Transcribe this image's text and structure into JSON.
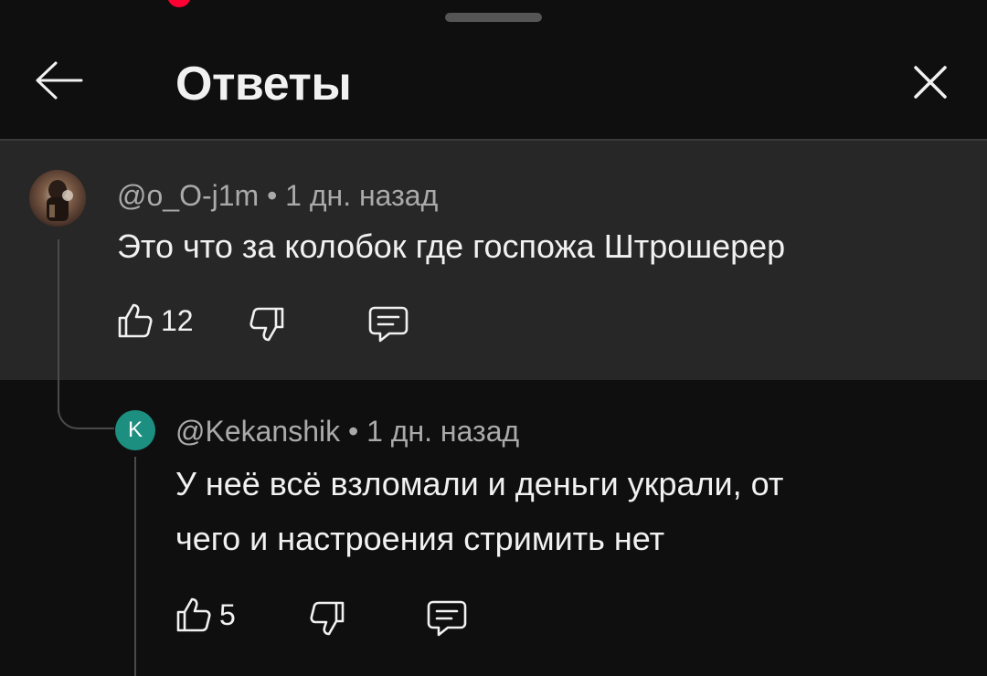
{
  "header": {
    "title": "Ответы",
    "back_icon": "arrow-left-icon",
    "close_icon": "close-icon"
  },
  "colors": {
    "background": "#0f0f0f",
    "highlight": "#272727",
    "meta_text": "#aaaaaa",
    "avatar_reply": "#1d8f80",
    "status_dot": "#ff0033"
  },
  "comments": [
    {
      "author": "@o_O-j1m",
      "time": "1 дн. назад",
      "text": "Это что за колобок где госпожа Штрошерер",
      "likes": "12",
      "highlighted": true
    },
    {
      "author": "@Kekanshik",
      "avatar_letter": "K",
      "time": "1 дн. назад",
      "text_line1": "У неё всё взломали и деньги украли, от",
      "text_line2": "чего и настроения стримить нет",
      "likes": "5",
      "highlighted": false
    }
  ]
}
